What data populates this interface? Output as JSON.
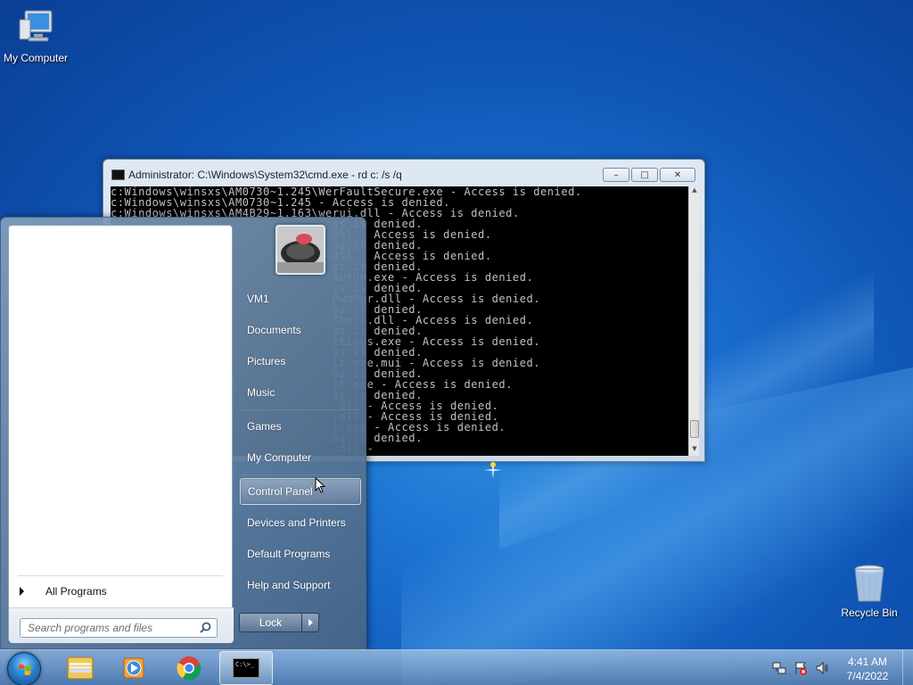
{
  "desktop": {
    "icons": [
      {
        "label": "My Computer",
        "icon": "computer-icon"
      },
      {
        "label": "Recycle Bin",
        "icon": "recycle-bin-icon"
      }
    ]
  },
  "cmd": {
    "title": "Administrator: C:\\Windows\\System32\\cmd.exe - rd  c: /s /q",
    "minimize": "–",
    "maximize": "□",
    "close": "✕",
    "lines": [
      "c:Windows\\winsxs\\AM0730~1.245\\WerFaultSecure.exe - Access is denied.",
      "c:Windows\\winsxs\\AM0730~1.245 - Access is denied.",
      "c:Windows\\winsxs\\AM4B29~1.163\\werui.dll - Access is denied.",
      "                                ss is denied.",
      "                                dll - Access is denied.",
      "                                ss is denied.",
      "                                dll - Access is denied.",
      "                                ss is denied.",
      "                                Authn.exe - Access is denied.",
      "                                ss is denied.",
      "                                PwdMgr.dll - Access is denied.",
      "                                ss is denied.",
      "                                Shell.dll - Access is denied.",
      "                                ss is denied.",
      "                                ttings.exe - Access is denied.",
      "                                ss is denied.",
      "                                it.exe.mui - Access is denied.",
      "                                ss is denied.",
      "                                it.exe - Access is denied.",
      "                                ss is denied.",
      "                                .dll - Access is denied.",
      "                                .dll - Access is denied.",
      "                                l.exe - Access is denied.",
      "                                ss is denied.",
      "                                .dll -"
    ]
  },
  "start_menu": {
    "all_programs": "All Programs",
    "search_placeholder": "Search programs and files",
    "right_items": [
      {
        "label": "VM1"
      },
      {
        "label": "Documents"
      },
      {
        "label": "Pictures"
      },
      {
        "label": "Music"
      },
      {
        "label": "Games"
      },
      {
        "label": "My Computer"
      },
      {
        "label": "Control Panel"
      },
      {
        "label": "Devices and Printers"
      },
      {
        "label": "Default Programs"
      },
      {
        "label": "Help and Support"
      }
    ],
    "lock_label": "Lock"
  },
  "taskbar": {
    "pinned": [
      {
        "icon": "explorer-folder-icon"
      },
      {
        "icon": "media-player-icon"
      },
      {
        "icon": "chrome-icon"
      },
      {
        "icon": "cmd-icon",
        "active": true
      }
    ],
    "cmd_icon_text": "C:\\>_",
    "tray": [
      "network-icon",
      "action-center-icon",
      "volume-icon"
    ],
    "time": "4:41 AM",
    "date": "7/4/2022"
  },
  "colors": {
    "desktop": "#1a6fcf",
    "console_bg": "#000000",
    "console_fg": "#c0c0c0"
  }
}
